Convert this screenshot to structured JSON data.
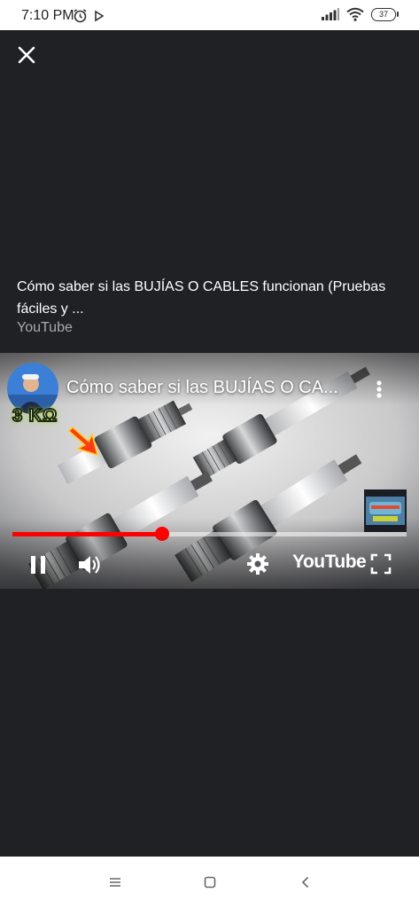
{
  "status_bar": {
    "time": "7:10 PM",
    "battery": "37"
  },
  "info": {
    "title": "Cómo saber si las BUJÍAS O CABLES funcionan (Pruebas fáciles y ...",
    "source": "YouTube"
  },
  "player": {
    "overlay_title": "Cómo saber si las BUJÍAS O CA...",
    "thumbnail_text": "3 KΩ",
    "progress": 0.38,
    "brand": "YouTube",
    "accent_color": "#ff0000"
  },
  "icons": {
    "close": "close-icon",
    "more": "more-vert-icon",
    "pause": "pause-icon",
    "volume": "volume-icon",
    "settings": "gear-icon",
    "fullscreen": "fullscreen-icon"
  }
}
